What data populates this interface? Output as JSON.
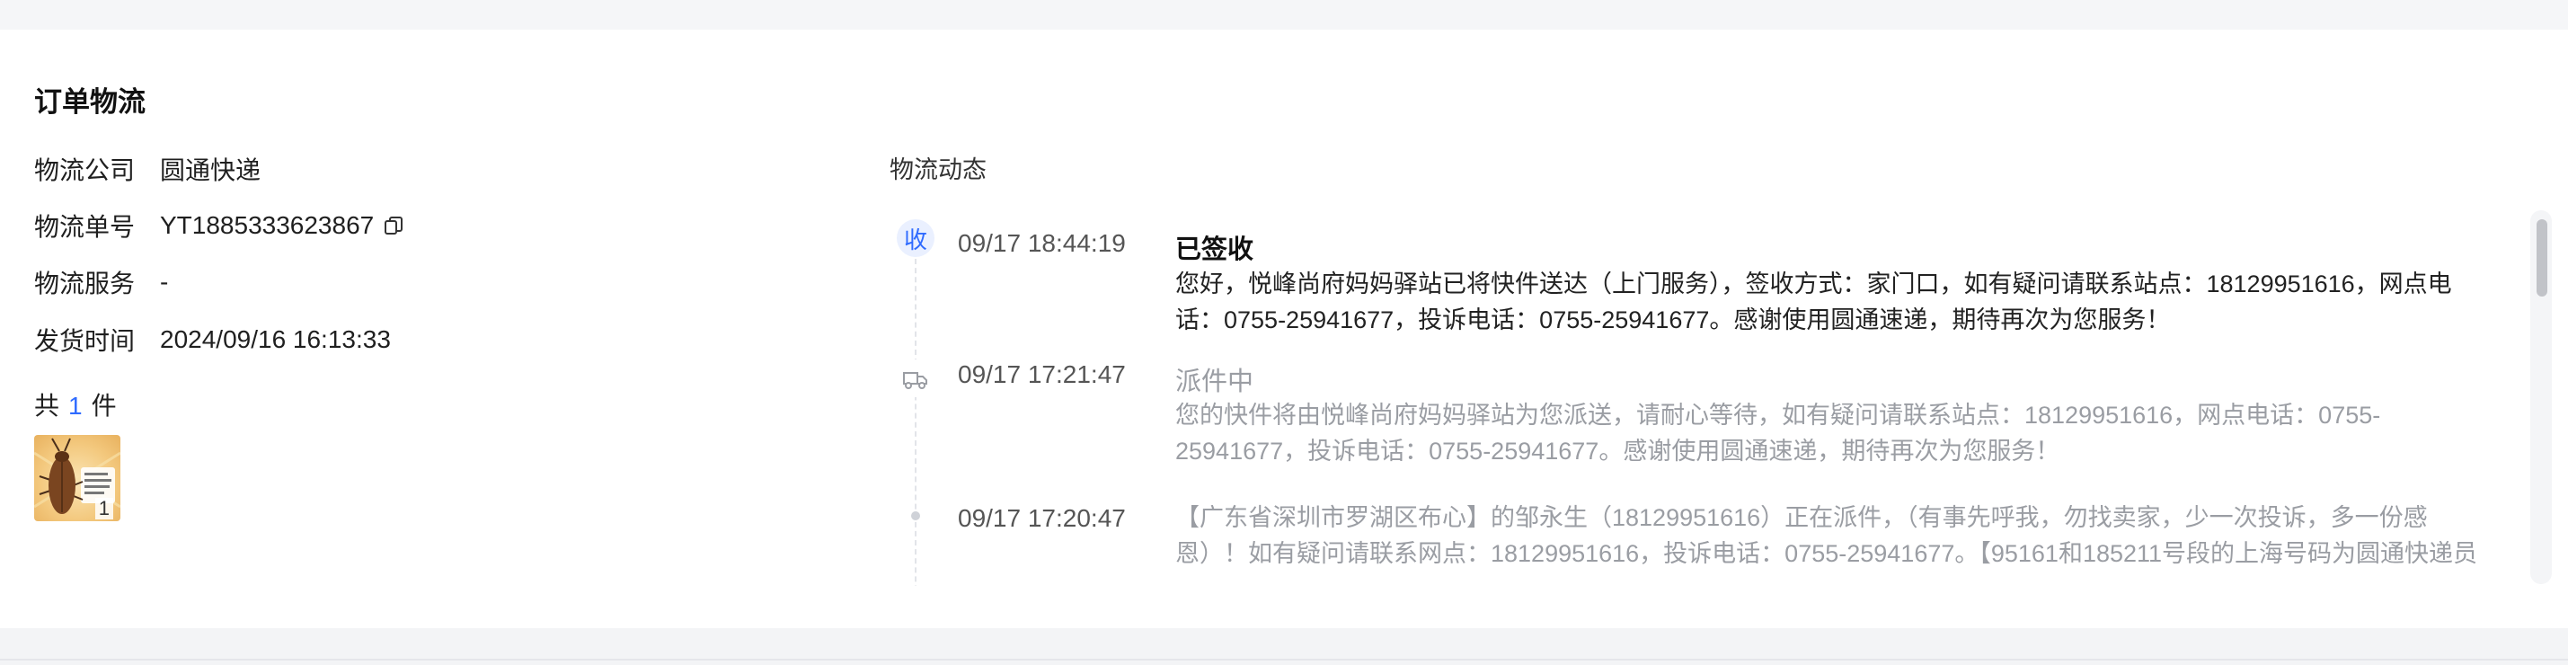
{
  "order_logistics": {
    "title": "订单物流",
    "company": {
      "label": "物流公司",
      "value": "圆通快递"
    },
    "tracking": {
      "label": "物流单号",
      "value": "YT1885333623867"
    },
    "service": {
      "label": "物流服务",
      "value": "-"
    },
    "ship_time": {
      "label": "发货时间",
      "value": "2024/09/16 16:13:33"
    },
    "item_count": {
      "prefix": "共",
      "count": "1",
      "suffix": "件"
    },
    "product": {
      "qty": "1",
      "thumbnail_icon": "cockroach-product-image"
    }
  },
  "timeline": {
    "header": "物流动态",
    "events": [
      {
        "node_label": "收",
        "node_icon": "signed-badge",
        "time": "09/17 18:44:19",
        "status": "已签收",
        "desc": "您好，悦峰尚府妈妈驿站已将快件送达（上门服务），签收方式：家门口，如有疑问请联系站点：18129951616，网点电话：0755-25941677，投诉电话：0755-25941677。感谢使用圆通速递，期待再次为您服务！"
      },
      {
        "node_icon": "delivery-truck-icon",
        "time": "09/17 17:21:47",
        "status": "派件中",
        "desc": "您的快件将由悦峰尚府妈妈驿站为您派送，请耐心等待，如有疑问请联系站点：18129951616，网点电话：0755-25941677，投诉电话：0755-25941677。感谢使用圆通速递，期待再次为您服务！"
      },
      {
        "node_icon": "dot-icon",
        "time": "09/17 17:20:47",
        "desc": "【广东省深圳市罗湖区布心】的邹永生（18129951616）正在派件，（有事先呼我，勿找卖家，少一次投诉，多一份感恩）！如有疑问请联系网点：18129951616，投诉电话：0755-25941677。【95161和185211号段的上海号码为圆通快递员"
      }
    ]
  },
  "colors": {
    "accent": "#2f6bff",
    "muted_text": "#9a9da3",
    "signed_badge_bg": "#eaf0ff"
  }
}
